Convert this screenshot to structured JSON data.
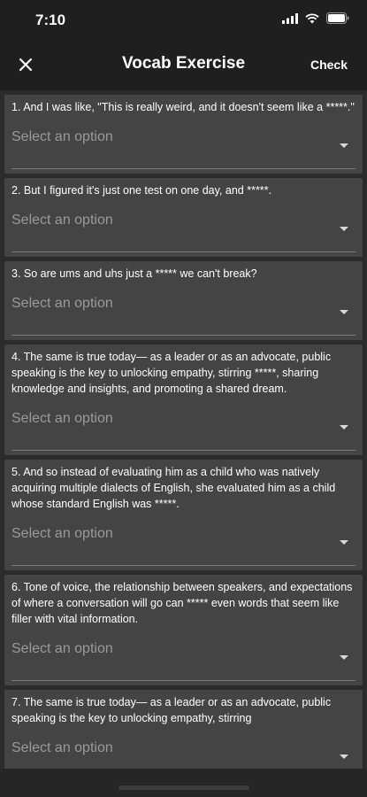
{
  "status": {
    "time": "7:10"
  },
  "header": {
    "title": "Vocab Exercise",
    "check_label": "Check"
  },
  "questions": [
    {
      "text": "1. And I was like, \"This is really weird, and it doesn't seem like a *****.\"",
      "select_placeholder": "Select an option"
    },
    {
      "text": "2. But I figured it's just one test on one day, and *****.",
      "select_placeholder": "Select an option"
    },
    {
      "text": "3. So are ums and uhs  just a ***** we can't break?",
      "select_placeholder": "Select an option"
    },
    {
      "text": "4. The same is true today— as a leader or as an advocate, public speaking is the key  to unlocking empathy, stirring *****, sharing knowledge and insights,  and promoting a shared dream.",
      "select_placeholder": "Select an option"
    },
    {
      "text": "5. And so instead of evaluating him as a child who was natively acquiring multiple dialects of English, she evaluated him as a child whose standard English was *****.",
      "select_placeholder": "Select an option"
    },
    {
      "text": "6. Tone of voice,  the relationship between speakers, and expectations of where  a conversation will go can ***** even words that seem like filler with vital information.",
      "select_placeholder": "Select an option"
    },
    {
      "text": "7. The same is true today— as a leader or as an advocate, public speaking is the key  to unlocking empathy, stirring",
      "select_placeholder": "Select an option"
    }
  ]
}
